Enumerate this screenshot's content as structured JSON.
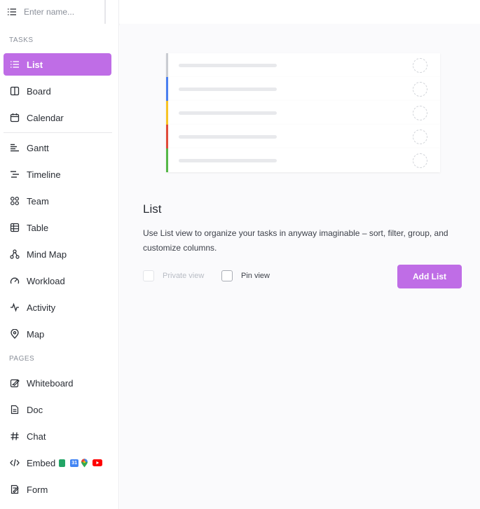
{
  "search": {
    "placeholder": "Enter name..."
  },
  "sidebar": {
    "tasks_label": "TASKS",
    "pages_label": "PAGES",
    "tasks": [
      {
        "label": "List",
        "icon": "list-icon",
        "active": true
      },
      {
        "label": "Board",
        "icon": "board-icon"
      },
      {
        "label": "Calendar",
        "icon": "calendar-icon"
      },
      {
        "label": "Gantt",
        "icon": "gantt-icon"
      },
      {
        "label": "Timeline",
        "icon": "timeline-icon"
      },
      {
        "label": "Team",
        "icon": "team-icon"
      },
      {
        "label": "Table",
        "icon": "table-icon"
      },
      {
        "label": "Mind Map",
        "icon": "mind-map-icon"
      },
      {
        "label": "Workload",
        "icon": "workload-icon"
      },
      {
        "label": "Activity",
        "icon": "activity-icon"
      },
      {
        "label": "Map",
        "icon": "map-pin-icon"
      }
    ],
    "pages": [
      {
        "label": "Whiteboard",
        "icon": "whiteboard-icon"
      },
      {
        "label": "Doc",
        "icon": "doc-icon"
      },
      {
        "label": "Chat",
        "icon": "hash-icon"
      },
      {
        "label": "Embed",
        "icon": "code-icon",
        "extras": [
          "google-sheets-icon",
          "google-calendar-icon",
          "google-maps-icon",
          "youtube-icon"
        ]
      },
      {
        "label": "Form",
        "icon": "form-icon"
      }
    ]
  },
  "illustration": {
    "row_colors": [
      "#c9ccd2",
      "#4a7ff0",
      "#f7c325",
      "#e04b3a",
      "#55b848"
    ]
  },
  "main": {
    "title": "List",
    "description": "Use List view to organize your tasks in anyway imaginable – sort, filter, group, and customize columns.",
    "private_view_label": "Private view",
    "pin_view_label": "Pin view",
    "add_button_label": "Add List"
  },
  "colors": {
    "accent": "#bf6de6"
  }
}
